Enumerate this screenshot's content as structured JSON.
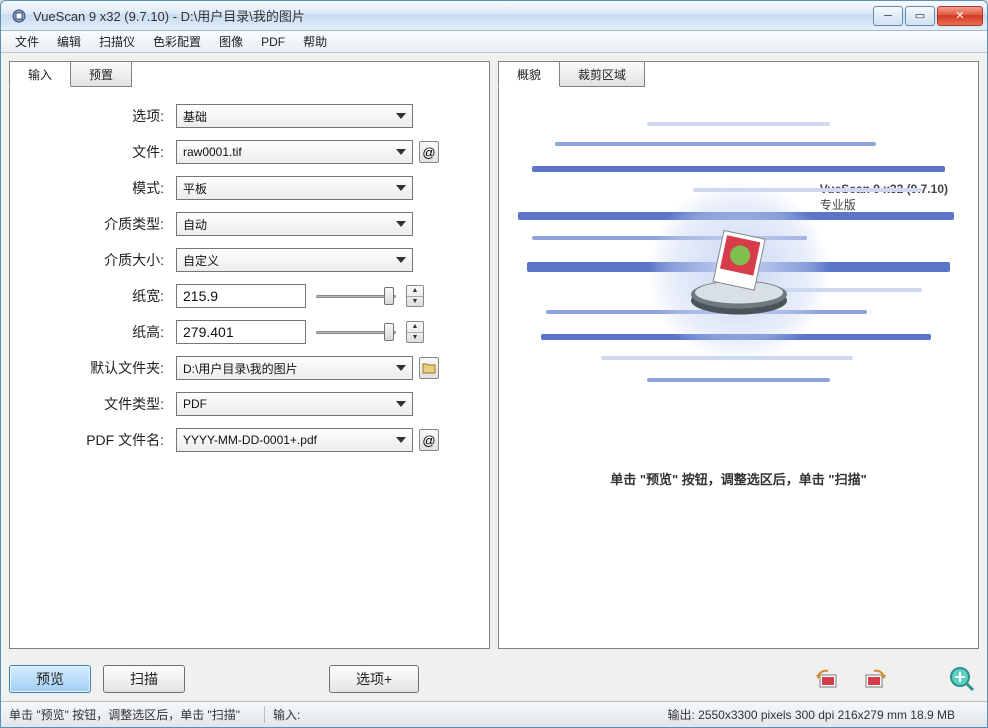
{
  "window": {
    "title": "VueScan 9 x32 (9.7.10) - D:\\用户目录\\我的图片"
  },
  "menu": {
    "file": "文件",
    "edit": "编辑",
    "scanner": "扫描仪",
    "color": "色彩配置",
    "image": "图像",
    "pdf": "PDF",
    "help": "帮助"
  },
  "left_tabs": {
    "input": "输入",
    "preset": "预置"
  },
  "right_tabs": {
    "overview": "概貌",
    "crop": "裁剪区域"
  },
  "labels": {
    "options": "选项:",
    "file": "文件:",
    "mode": "模式:",
    "media_type": "介质类型:",
    "media_size": "介质大小:",
    "paper_w": "纸宽:",
    "paper_h": "纸高:",
    "default_folder": "默认文件夹:",
    "file_type": "文件类型:",
    "pdf_name": "PDF 文件名:"
  },
  "values": {
    "options": "基础",
    "file": "raw0001.tif",
    "mode": "平板",
    "media_type": "自动",
    "media_size": "自定义",
    "paper_w": "215.9",
    "paper_h": "279.401",
    "default_folder": "D:\\用户目录\\我的图片",
    "file_type": "PDF",
    "pdf_name": "YYYY-MM-DD-0001+.pdf"
  },
  "buttons": {
    "preview": "预览",
    "scan": "扫描",
    "options_more": "选项+"
  },
  "brand": {
    "name": "VueScan 9 x32 (9.7.10)",
    "edition": "专业版"
  },
  "hint_text": "单击 \"预览\" 按钮，调整选区后，单击 \"扫描\"",
  "status": {
    "left": "单击 \"预览\" 按钮，调整选区后，单击 \"扫描\"",
    "mid_label": "输入:",
    "right": "输出: 2550x3300 pixels 300 dpi 216x279 mm 18.9 MB"
  },
  "icons": {
    "at": "@",
    "folder": "🗀"
  }
}
